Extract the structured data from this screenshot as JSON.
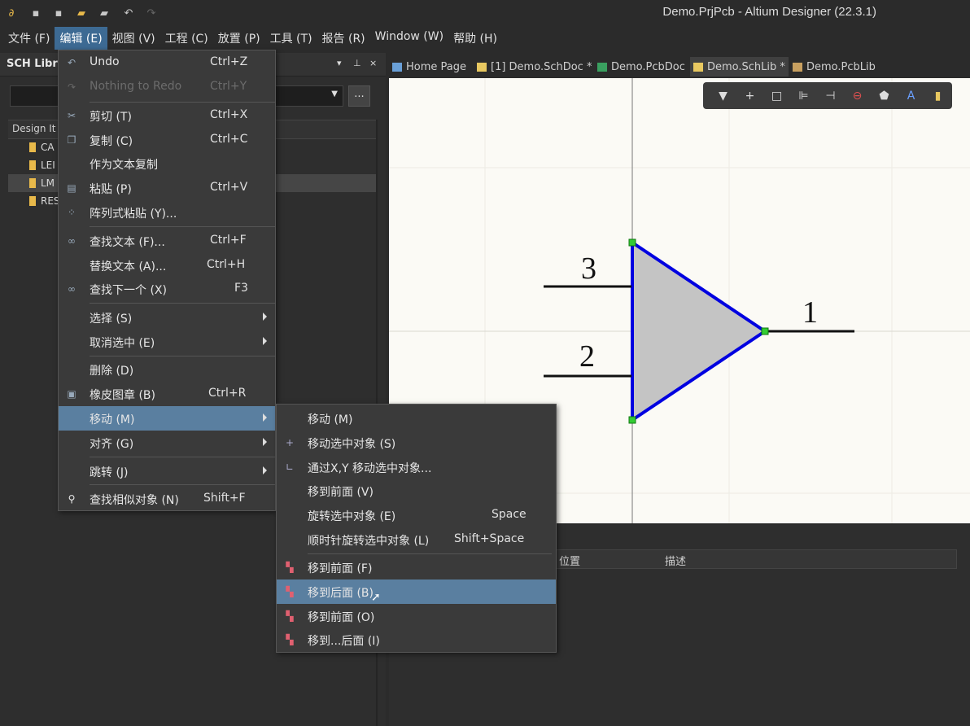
{
  "window": {
    "title": "Demo.PrjPcb - Altium Designer (22.3.1)"
  },
  "menubar": [
    {
      "label": "文件 (F)"
    },
    {
      "label": "编辑 (E)"
    },
    {
      "label": "视图 (V)"
    },
    {
      "label": "工程 (C)"
    },
    {
      "label": "放置 (P)"
    },
    {
      "label": "工具 (T)"
    },
    {
      "label": "报告 (R)"
    },
    {
      "label": "Window (W)"
    },
    {
      "label": "帮助 (H)"
    }
  ],
  "left_panel": {
    "title": "SCH Libra",
    "combo_button": "...",
    "list_header": "Design It",
    "items": [
      {
        "label": "CA"
      },
      {
        "label": "LEI"
      },
      {
        "label": "LM"
      },
      {
        "label": "RES"
      }
    ]
  },
  "tabs": [
    {
      "label": "Home Page"
    },
    {
      "label": "[1] Demo.SchDoc *"
    },
    {
      "label": "Demo.PcbDoc"
    },
    {
      "label": "Demo.SchLib *"
    },
    {
      "label": "Demo.PcbLib"
    }
  ],
  "schematic": {
    "pins": [
      {
        "number": "3"
      },
      {
        "number": "2"
      },
      {
        "number": "1"
      }
    ]
  },
  "bottom_panel": {
    "col_position": "位置",
    "col_description": "描述"
  },
  "edit_menu": {
    "undo": {
      "label": "Undo",
      "shortcut": "Ctrl+Z"
    },
    "redo": {
      "label": "Nothing to Redo",
      "shortcut": "Ctrl+Y"
    },
    "cut": {
      "label": "剪切 (T)",
      "shortcut": "Ctrl+X"
    },
    "copy": {
      "label": "复制 (C)",
      "shortcut": "Ctrl+C"
    },
    "copy_text": {
      "label": "作为文本复制"
    },
    "paste": {
      "label": "粘贴 (P)",
      "shortcut": "Ctrl+V"
    },
    "paste_array": {
      "label": "阵列式粘贴 (Y)..."
    },
    "find_text": {
      "label": "查找文本 (F)...",
      "shortcut": "Ctrl+F"
    },
    "replace_text": {
      "label": "替换文本 (A)...",
      "shortcut": "Ctrl+H"
    },
    "find_next": {
      "label": "查找下一个 (X)",
      "shortcut": "F3"
    },
    "select": {
      "label": "选择 (S)"
    },
    "deselect": {
      "label": "取消选中 (E)"
    },
    "delete": {
      "label": "删除 (D)"
    },
    "rubber_stamp": {
      "label": "橡皮图章 (B)",
      "shortcut": "Ctrl+R"
    },
    "move": {
      "label": "移动 (M)"
    },
    "align": {
      "label": "对齐 (G)"
    },
    "jump": {
      "label": "跳转 (J)"
    },
    "find_similar": {
      "label": "查找相似对象 (N)",
      "shortcut": "Shift+F"
    }
  },
  "move_submenu": {
    "move": {
      "label": "移动 (M)"
    },
    "move_selection": {
      "label": "移动选中对象 (S)"
    },
    "move_xy": {
      "label": "通过X,Y 移动选中对象..."
    },
    "bring_front": {
      "label": "移到前面 (V)"
    },
    "rotate": {
      "label": "旋转选中对象 (E)",
      "shortcut": "Space"
    },
    "rotate_cw": {
      "label": "顺时针旋转选中对象 (L)",
      "shortcut": "Shift+Space"
    },
    "to_front": {
      "label": "移到前面 (F)"
    },
    "to_back": {
      "label": "移到后面 (B)"
    },
    "to_front_of": {
      "label": "移到前面 (O)"
    },
    "to_back_of": {
      "label": "移到...后面 (I)"
    }
  }
}
